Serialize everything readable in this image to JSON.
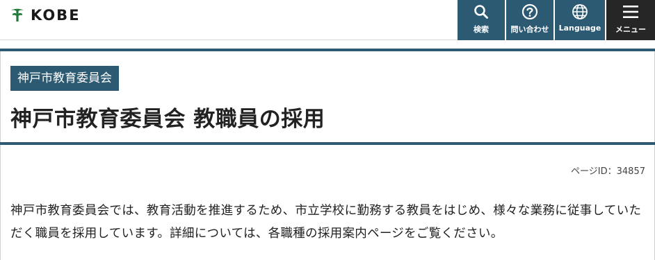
{
  "header": {
    "logo_text": "KOBE",
    "utility_nav": [
      {
        "label": "検索",
        "icon": "search-icon"
      },
      {
        "label": "問い合わせ",
        "icon": "question-circle-icon"
      },
      {
        "label": "Language",
        "icon": "globe-icon"
      },
      {
        "label": "メニュー",
        "icon": "hamburger-menu-icon"
      }
    ]
  },
  "colors": {
    "accent": "#2d5a73",
    "menu_button": "#262626",
    "logo_green": "#1f7a3a"
  },
  "main": {
    "category_label": "神戸市教育委員会",
    "page_title": "神戸市教育委員会 教職員の採用",
    "page_id": "ページID：34857",
    "intro_text": "神戸市教育委員会では、教育活動を推進するため、市立学校に勤務する教員をはじめ、様々な業務に従事していただく職員を採用しています。詳細については、各職種の採用案内ページをご覧ください。"
  }
}
